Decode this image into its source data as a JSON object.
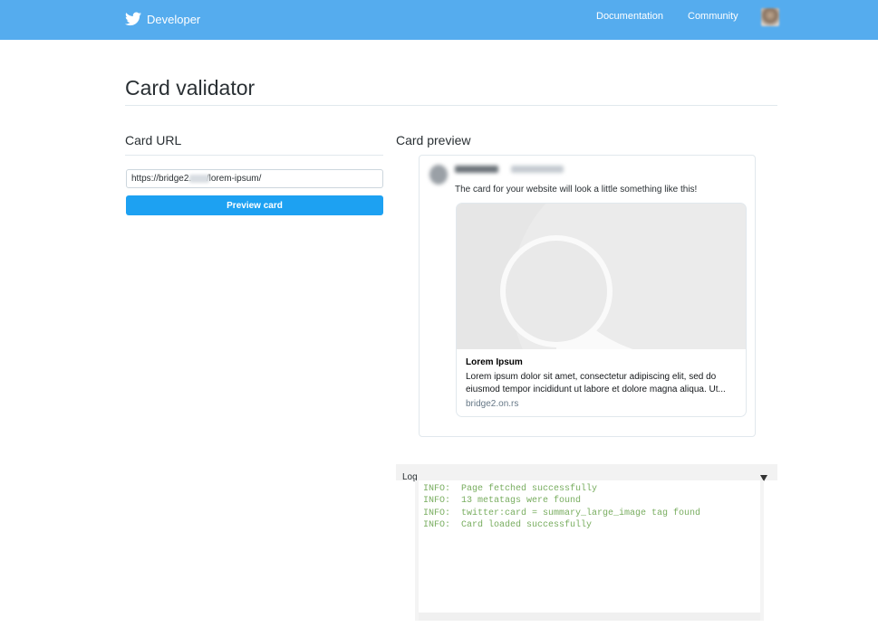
{
  "header": {
    "brand": "Developer",
    "nav": [
      "Documentation",
      "Community"
    ]
  },
  "page": {
    "title": "Card validator"
  },
  "card_url": {
    "heading": "Card URL",
    "input_value": "https://bridge2.      /lorem-ipsum/",
    "button_label": "Preview card"
  },
  "preview": {
    "heading": "Card preview",
    "tweet_text": "The card for your website will look a little something like this!",
    "card": {
      "title": "Lorem Ipsum",
      "description": "Lorem ipsum dolor sit amet, consectetur adipiscing elit, sed do eiusmod tempor incididunt ut labore et dolore magna aliqua. Ut...",
      "domain": "bridge2.on.rs"
    }
  },
  "log": {
    "label": "Log",
    "lines": [
      "INFO:  Page fetched successfully",
      "INFO:  13 metatags were found",
      "INFO:  twitter:card = summary_large_image tag found",
      "INFO:  Card loaded successfully"
    ]
  },
  "colors": {
    "header_bg": "#55acee",
    "button_bg": "#1da1f2",
    "log_text": "#78ad5f"
  }
}
